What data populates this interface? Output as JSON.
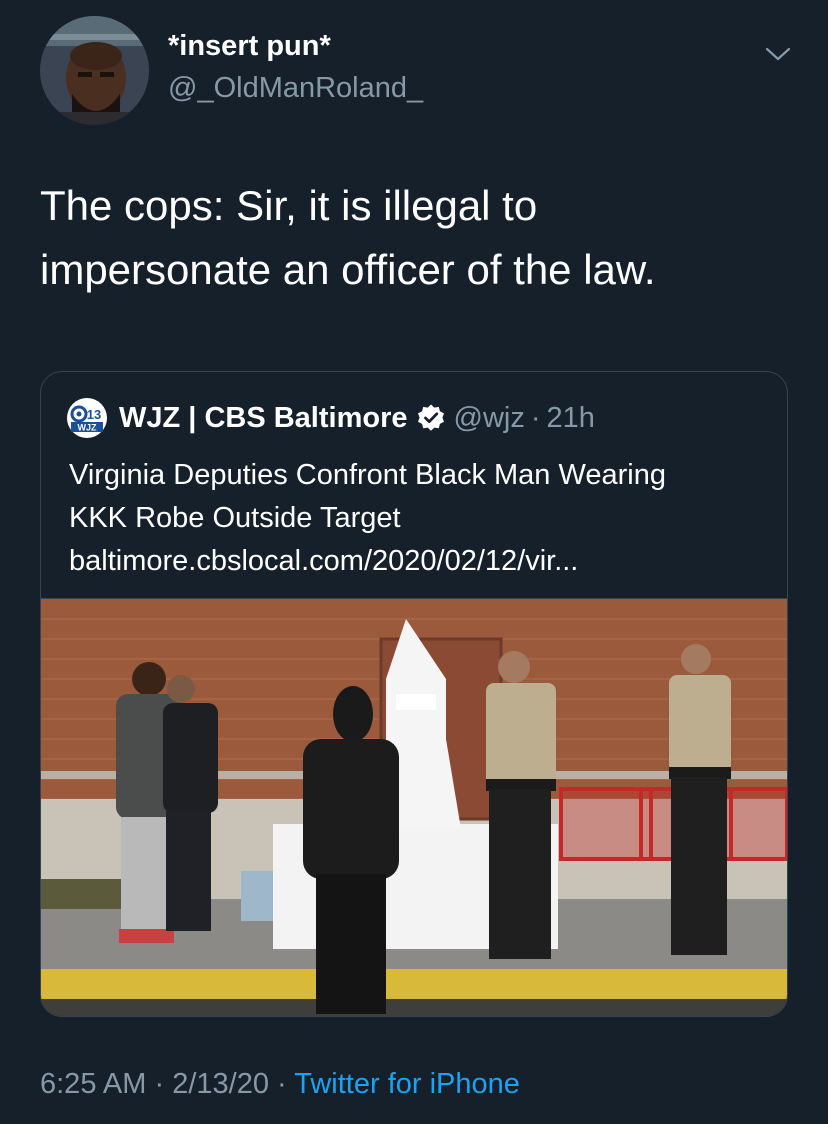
{
  "author": {
    "display_name": "*insert pun*",
    "handle": "@_OldManRoland_"
  },
  "icons": {
    "menu": "chevron-down-icon",
    "verified": "verified-badge-icon",
    "avatar": "profile-photo"
  },
  "tweet": {
    "text_line1": "The cops: Sir, it is illegal to",
    "text_line2": "impersonate an officer of the law."
  },
  "quoted": {
    "logo_text_top": "13",
    "logo_text_bottom": "WJZ",
    "name": "WJZ | CBS Baltimore",
    "handle": "@wjz",
    "separator": "·",
    "time": "21h",
    "text_line1": "Virginia Deputies Confront Black Man Wearing",
    "text_line2": "KKK Robe Outside Target",
    "link": "baltimore.cbslocal.com/2020/02/12/vir..."
  },
  "footer": {
    "time": "6:25 AM",
    "separator1": "·",
    "date": "2/13/20",
    "separator2": "·",
    "source": "Twitter for iPhone"
  },
  "colors": {
    "background": "#15202b",
    "text_primary": "#ffffff",
    "text_secondary": "#8899a6",
    "link_blue": "#1da1f2",
    "border": "#38444d",
    "verified_fill": "#ffffff"
  }
}
